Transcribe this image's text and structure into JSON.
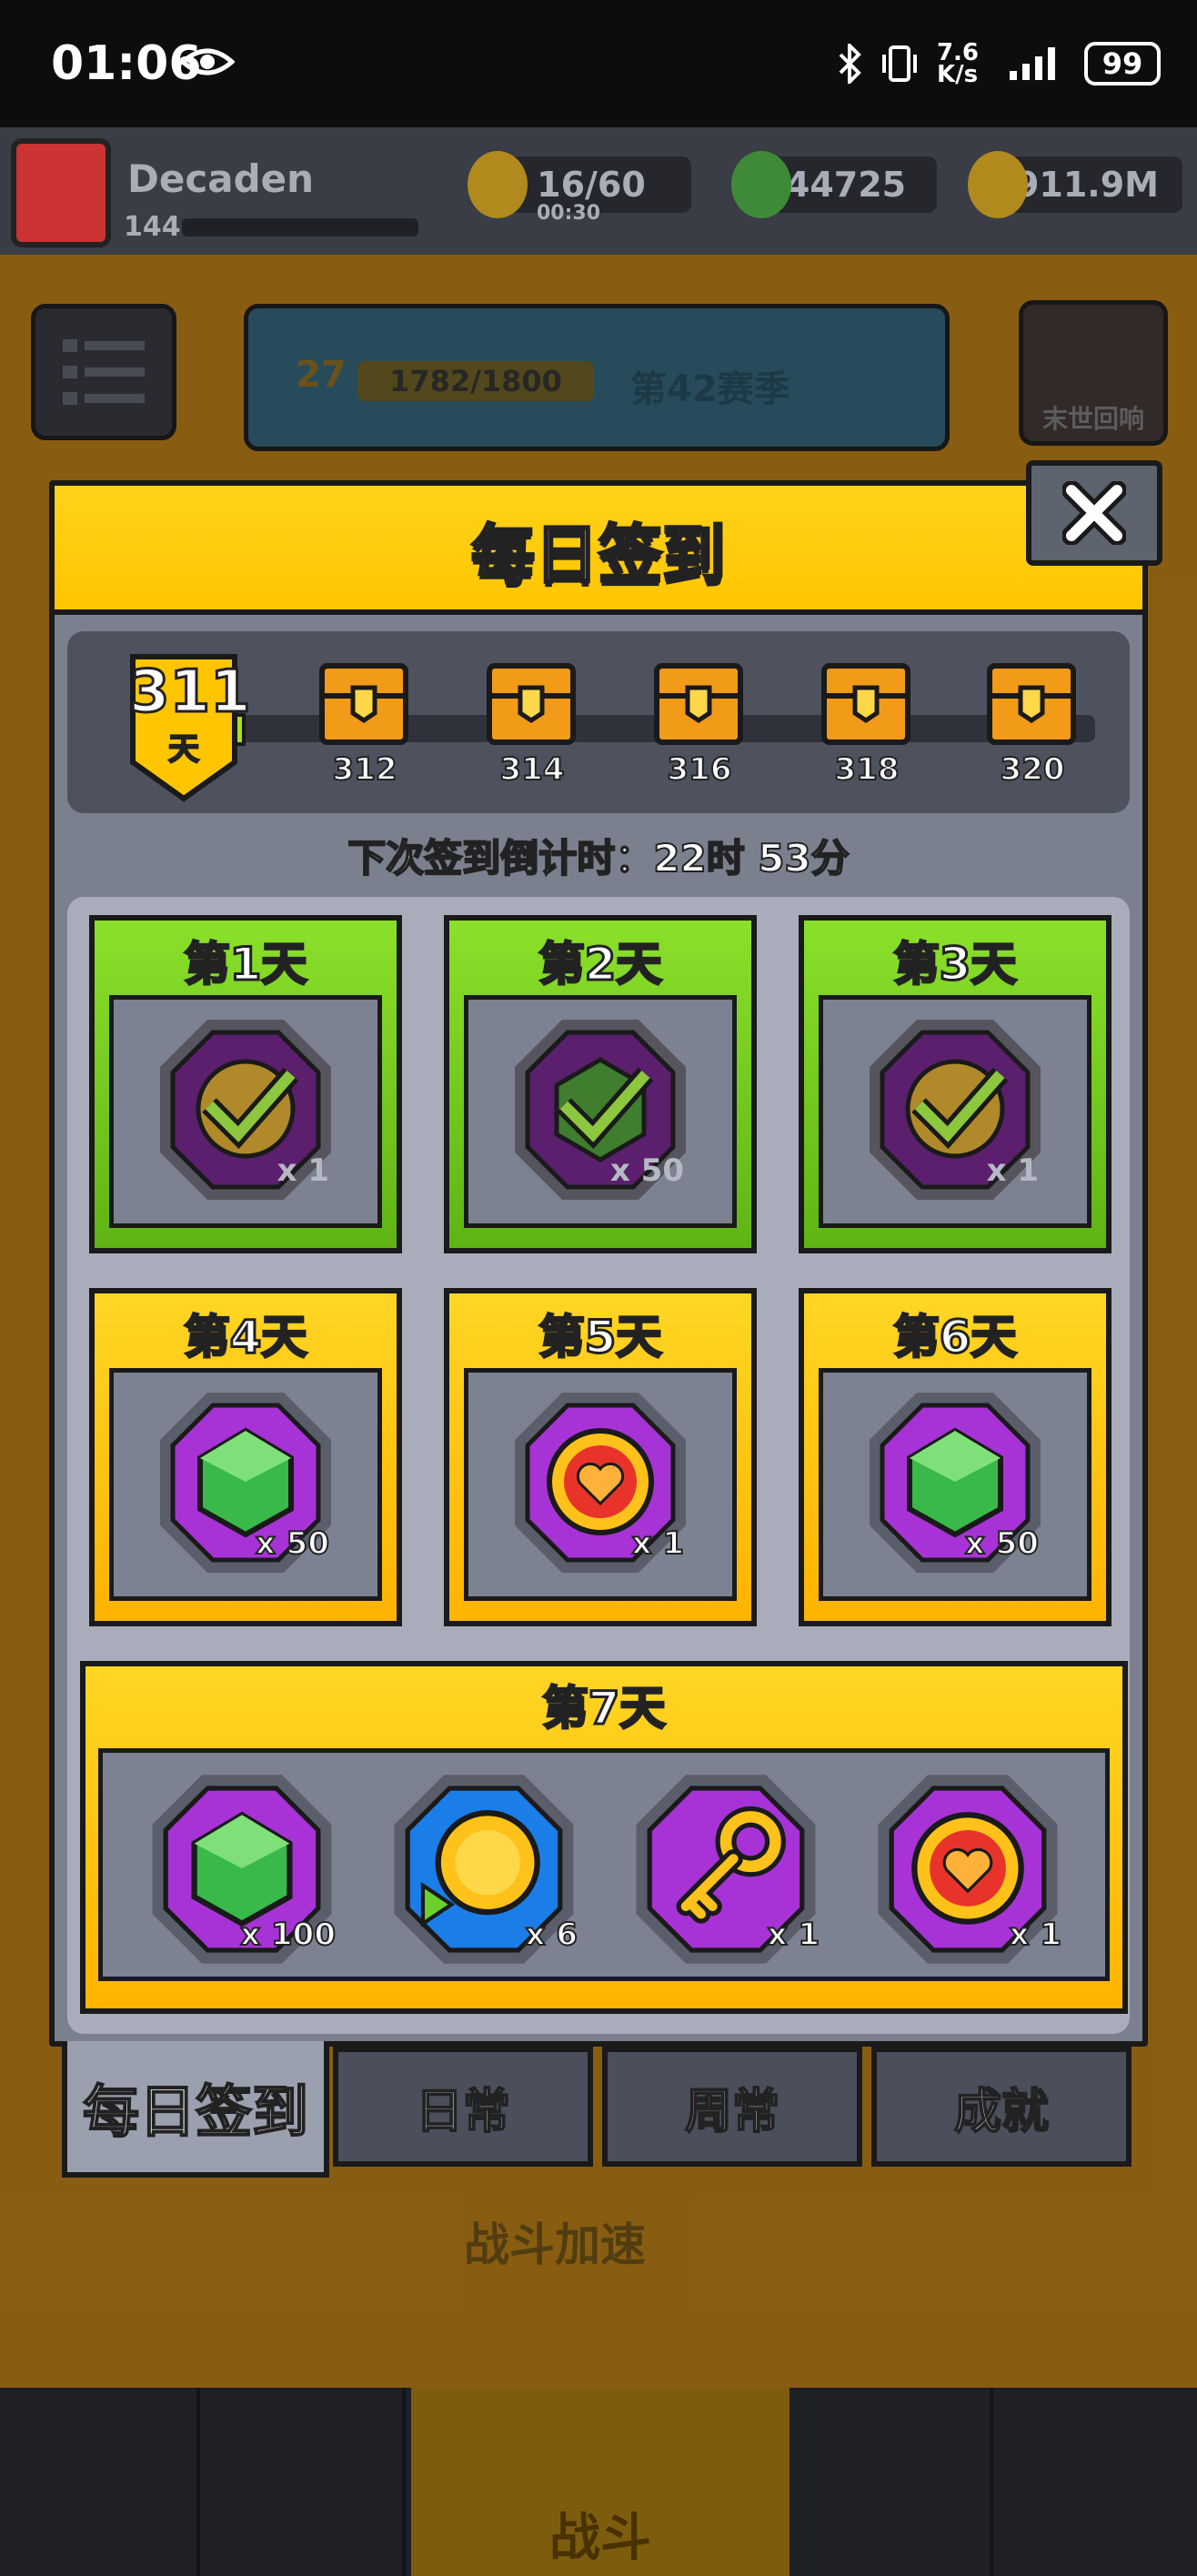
{
  "status_bar": {
    "time": "01:06",
    "net_speed_value": "7.6",
    "net_speed_unit": "K/s",
    "battery": "99"
  },
  "hud": {
    "player_name": "Decaden",
    "player_level": "144",
    "energy": "16/60",
    "energy_timer": "00:30",
    "gems": "44725",
    "coins": "911.9M"
  },
  "season": {
    "level": "27",
    "xp": "1782/1800",
    "label": "第42赛季"
  },
  "event_button_label": "末世回响",
  "background": {
    "speedup_label": "战斗加速",
    "fight_label": "战斗"
  },
  "modal": {
    "title": "每日签到",
    "streak_days": "311",
    "streak_unit": "天",
    "milestones": [
      "312",
      "314",
      "316",
      "318",
      "320"
    ],
    "countdown": "下次签到倒计时：22时 53分",
    "days": [
      {
        "label": "第1天",
        "state": "claimed",
        "reward": "coin",
        "qty": "x 1"
      },
      {
        "label": "第2天",
        "state": "claimed",
        "reward": "gem",
        "qty": "x 50"
      },
      {
        "label": "第3天",
        "state": "claimed",
        "reward": "coin",
        "qty": "x 1"
      },
      {
        "label": "第4天",
        "state": "pending",
        "reward": "gem",
        "qty": "x 50"
      },
      {
        "label": "第5天",
        "state": "pending",
        "reward": "heart",
        "qty": "x 1"
      },
      {
        "label": "第6天",
        "state": "pending",
        "reward": "gem",
        "qty": "x 50"
      }
    ],
    "day7": {
      "label": "第7天",
      "rewards": [
        {
          "icon": "gem-icon",
          "qty": "x 100"
        },
        {
          "icon": "gold-coin-play-icon",
          "qty": "x 6"
        },
        {
          "icon": "key-icon",
          "qty": "x 1"
        },
        {
          "icon": "heart-icon",
          "qty": "x 1"
        }
      ]
    }
  },
  "tabs": [
    {
      "label": "每日签到",
      "active": true
    },
    {
      "label": "日常",
      "active": false
    },
    {
      "label": "周常",
      "active": false
    },
    {
      "label": "成就",
      "active": false
    }
  ],
  "colors": {
    "header_yellow": "#ffc600",
    "claimed_green": "#6fc41a",
    "panel_gray": "#7b808e",
    "reward_purple": "#a733d6"
  }
}
